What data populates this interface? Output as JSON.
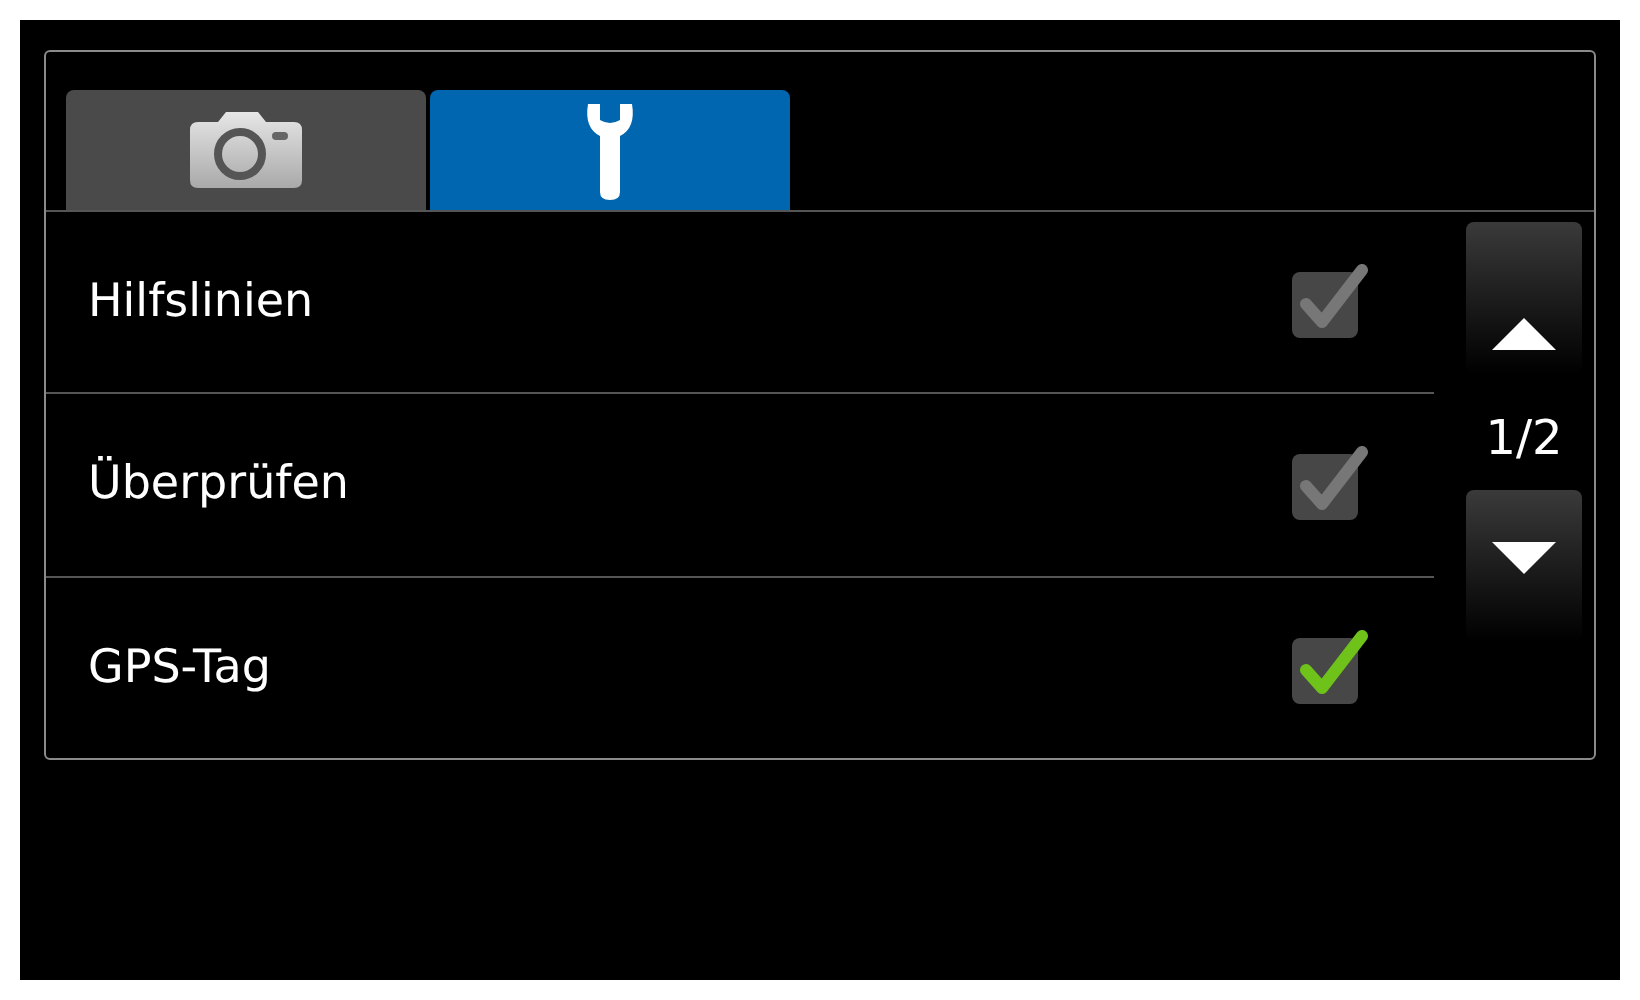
{
  "tabs": [
    {
      "kind": "camera",
      "selected": false
    },
    {
      "kind": "settings",
      "selected": true
    }
  ],
  "settings": [
    {
      "label": "Hilfslinien",
      "checked": false
    },
    {
      "label": "Überprüfen",
      "checked": false
    },
    {
      "label": "GPS-Tag",
      "checked": true
    }
  ],
  "pager": {
    "page": "1/2"
  }
}
